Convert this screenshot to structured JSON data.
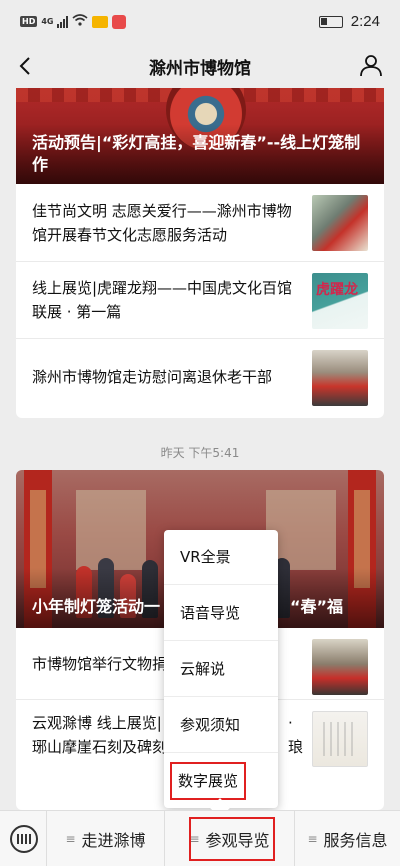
{
  "status_bar": {
    "hd_badge": "HD",
    "network": "4G",
    "time": "2:24"
  },
  "nav": {
    "title": "滁州市博物馆"
  },
  "card1": {
    "hero_title": "活动预告|“彩灯高挂，喜迎新春”--线上灯笼制作",
    "items": [
      {
        "title": "佳节尚文明 志愿关爱行——滁州市博物馆开展春节文化志愿服务活动"
      },
      {
        "title": "线上展览|虎躍龙翔——中国虎文化百馆联展 · 第一篇",
        "thumb_text": "虎躍龙"
      },
      {
        "title": "滁州市博物馆走访慰问离退休老干部"
      }
    ]
  },
  "timestamp": "昨天 下午5:41",
  "card2": {
    "hero_title": "小年制灯笼活动一",
    "hero_title_tail": "“春”福",
    "items": [
      {
        "title": "市博物馆举行文物捐"
      },
      {
        "title": "云观滁博 线上展览|",
        "title_line2": "琊山摩崖石刻及碑刻",
        "title_tail": "·琅"
      }
    ]
  },
  "popup_menu": {
    "items": [
      {
        "label": "VR全景"
      },
      {
        "label": "语音导览"
      },
      {
        "label": "云解说"
      },
      {
        "label": "参观须知"
      },
      {
        "label": "数字展览"
      }
    ],
    "highlighted": "数字展览"
  },
  "bottom_bar": {
    "tabs": [
      {
        "label": "走进滁博"
      },
      {
        "label": "参观导览"
      },
      {
        "label": "服务信息"
      }
    ],
    "highlighted": "参观导览"
  },
  "colors": {
    "highlight": "#e02020",
    "background": "#ededed"
  }
}
